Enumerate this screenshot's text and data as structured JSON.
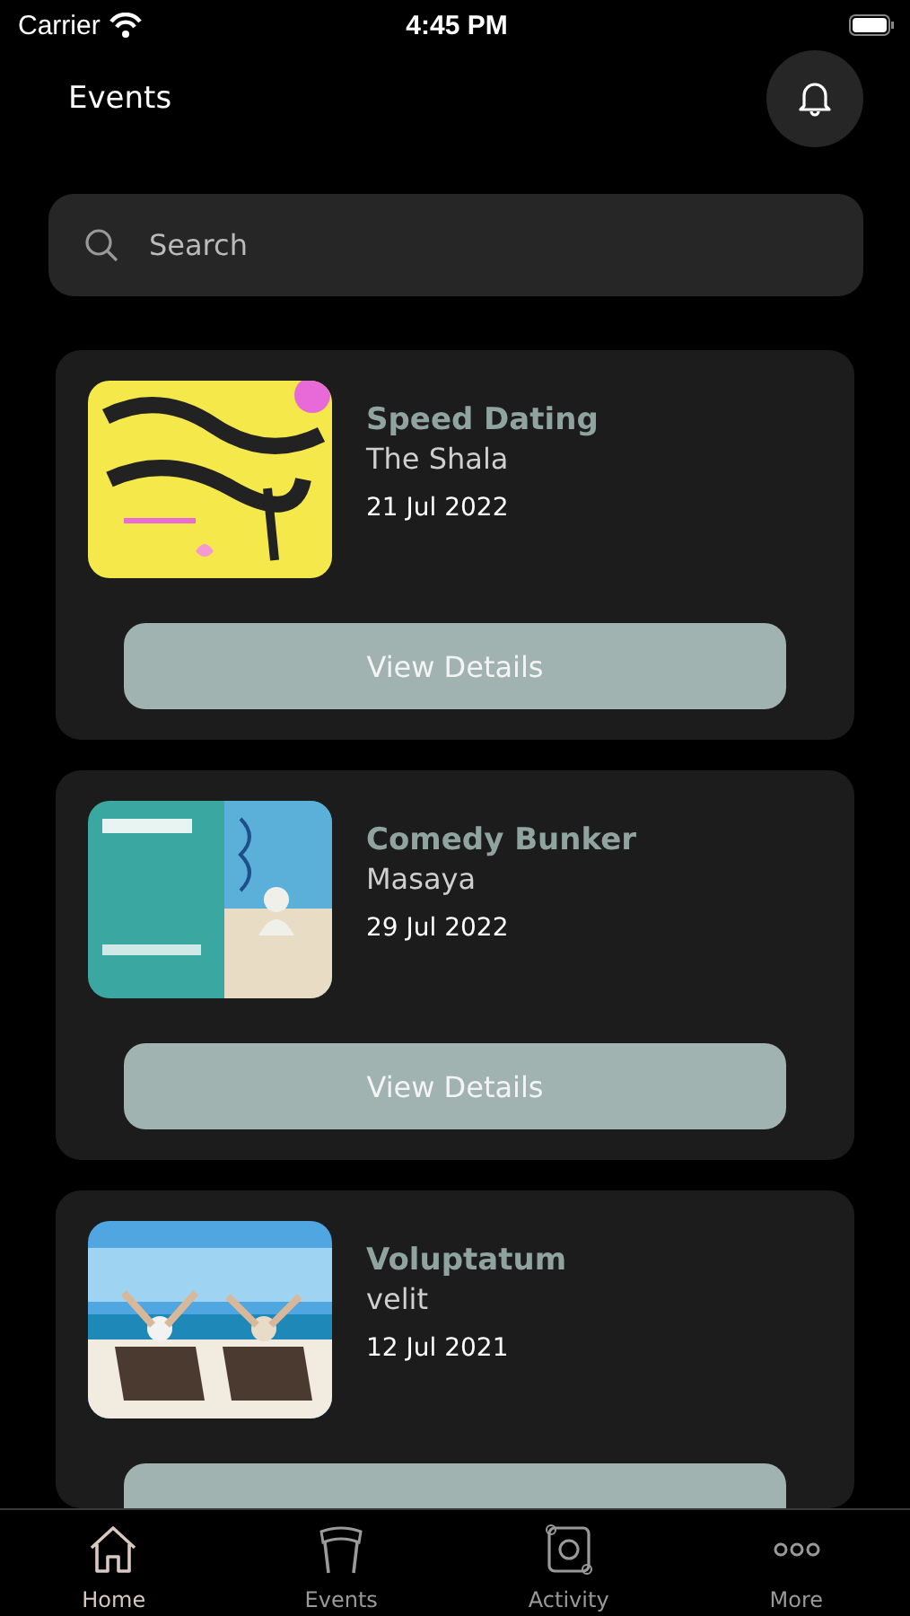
{
  "status_bar": {
    "carrier": "Carrier",
    "time": "4:45 PM"
  },
  "header": {
    "title": "Events"
  },
  "search": {
    "placeholder": "Search"
  },
  "events": [
    {
      "title": "Speed Dating",
      "venue": "The Shala",
      "date": "21 Jul 2022",
      "button": "View Details"
    },
    {
      "title": "Comedy Bunker",
      "venue": "Masaya",
      "date": "29 Jul 2022",
      "button": "View Details"
    },
    {
      "title": "Voluptatum",
      "venue": "velit",
      "date": "12 Jul 2021"
    }
  ],
  "tab_bar": [
    {
      "label": "Home",
      "selected": true
    },
    {
      "label": "Events",
      "selected": false
    },
    {
      "label": "Activity",
      "selected": false
    },
    {
      "label": "More",
      "selected": false
    }
  ]
}
